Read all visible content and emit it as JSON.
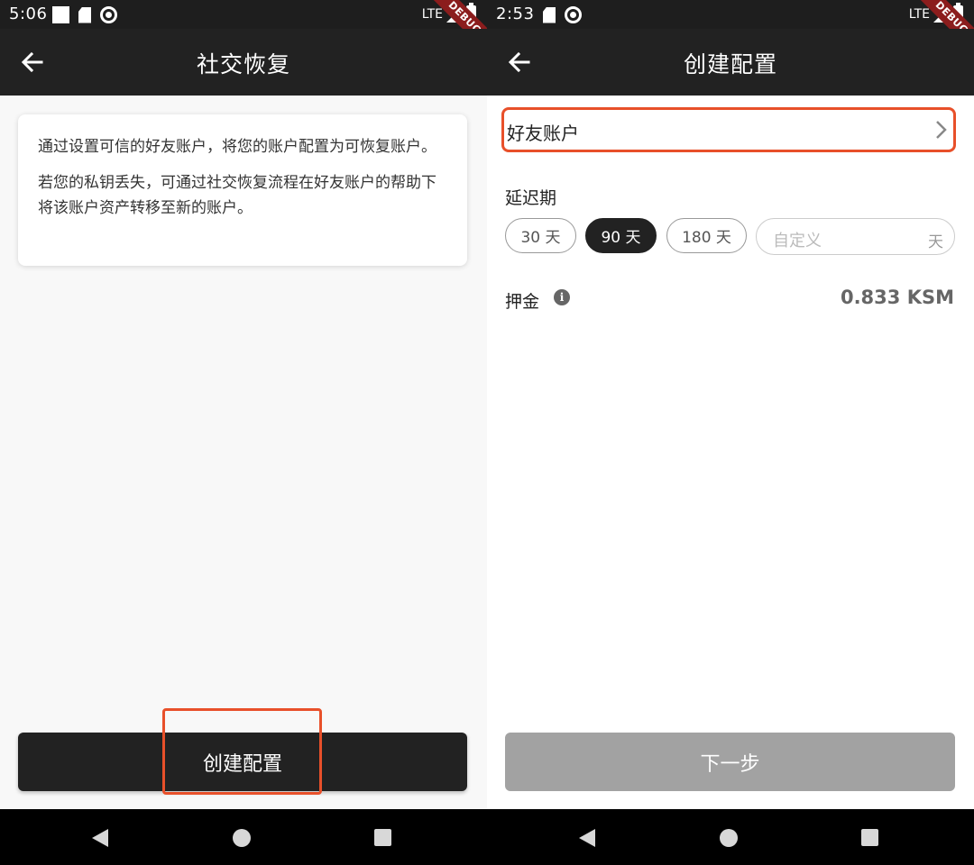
{
  "left_screen": {
    "status": {
      "time": "5:06",
      "network": "LTE"
    },
    "debug_banner": "DEBUG",
    "appbar": {
      "title": "社交恢复"
    },
    "info_card": {
      "paragraph1": "通过设置可信的好友账户，将您的账户配置为可恢复账户。",
      "paragraph2": "若您的私钥丢失，可通过社交恢复流程在好友账户的帮助下将该账户资产转移至新的账户。"
    },
    "create_button": "创建配置"
  },
  "right_screen": {
    "status": {
      "time": "2:53",
      "network": "LTE"
    },
    "debug_banner": "DEBUG",
    "appbar": {
      "title": "创建配置"
    },
    "friend_accounts": {
      "label": "好友账户"
    },
    "delay": {
      "label": "延迟期",
      "options": [
        {
          "label": "30 天",
          "selected": false
        },
        {
          "label": "90 天",
          "selected": true
        },
        {
          "label": "180 天",
          "selected": false
        }
      ],
      "custom_placeholder": "自定义",
      "custom_unit": "天"
    },
    "deposit": {
      "label": "押金",
      "value": "0.833 KSM"
    },
    "next_button": "下一步"
  },
  "colors": {
    "appbar": "#222222",
    "highlight": "#e8502a",
    "disabled_button": "#a2a2a2"
  }
}
